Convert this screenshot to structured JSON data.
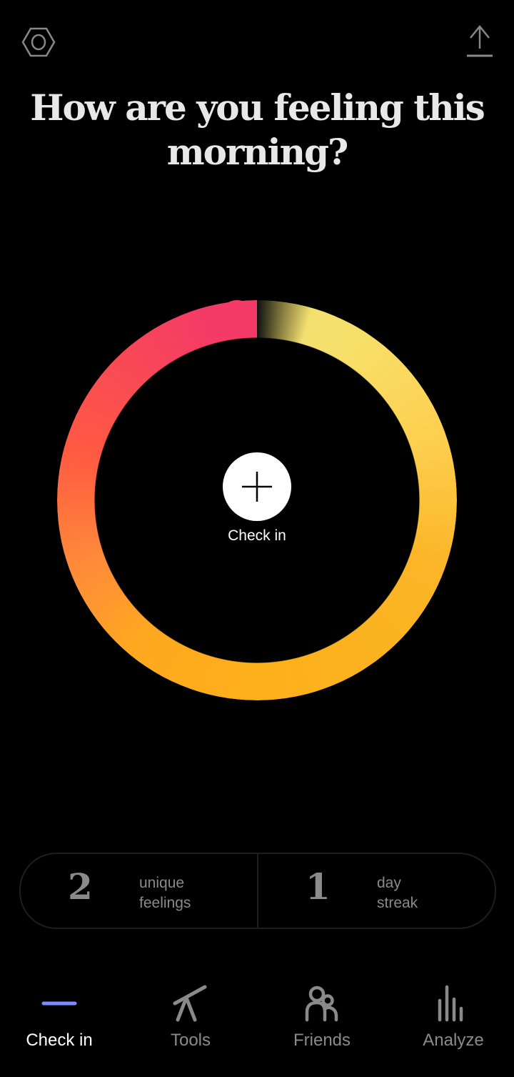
{
  "header": {
    "settings_icon": "hexagon-settings-icon",
    "share_icon": "share-upload-icon",
    "title": "How are you feeling this morning?"
  },
  "ring": {
    "colors": [
      "#f4e070",
      "#fdd050",
      "#fdb01a",
      "#ff8a3a",
      "#ff5a42",
      "#f43a66"
    ]
  },
  "checkin": {
    "icon": "plus-icon",
    "label": "Check in"
  },
  "stats": [
    {
      "value": "2",
      "label_line1": "unique",
      "label_line2": "feelings"
    },
    {
      "value": "1",
      "label_line1": "day",
      "label_line2": "streak"
    }
  ],
  "nav": {
    "items": [
      {
        "label": "Check in",
        "icon": "plus-icon",
        "active": true
      },
      {
        "label": "Tools",
        "icon": "tools-icon",
        "active": false
      },
      {
        "label": "Friends",
        "icon": "friends-icon",
        "active": false
      },
      {
        "label": "Analyze",
        "icon": "bar-chart-icon",
        "active": false
      }
    ]
  }
}
